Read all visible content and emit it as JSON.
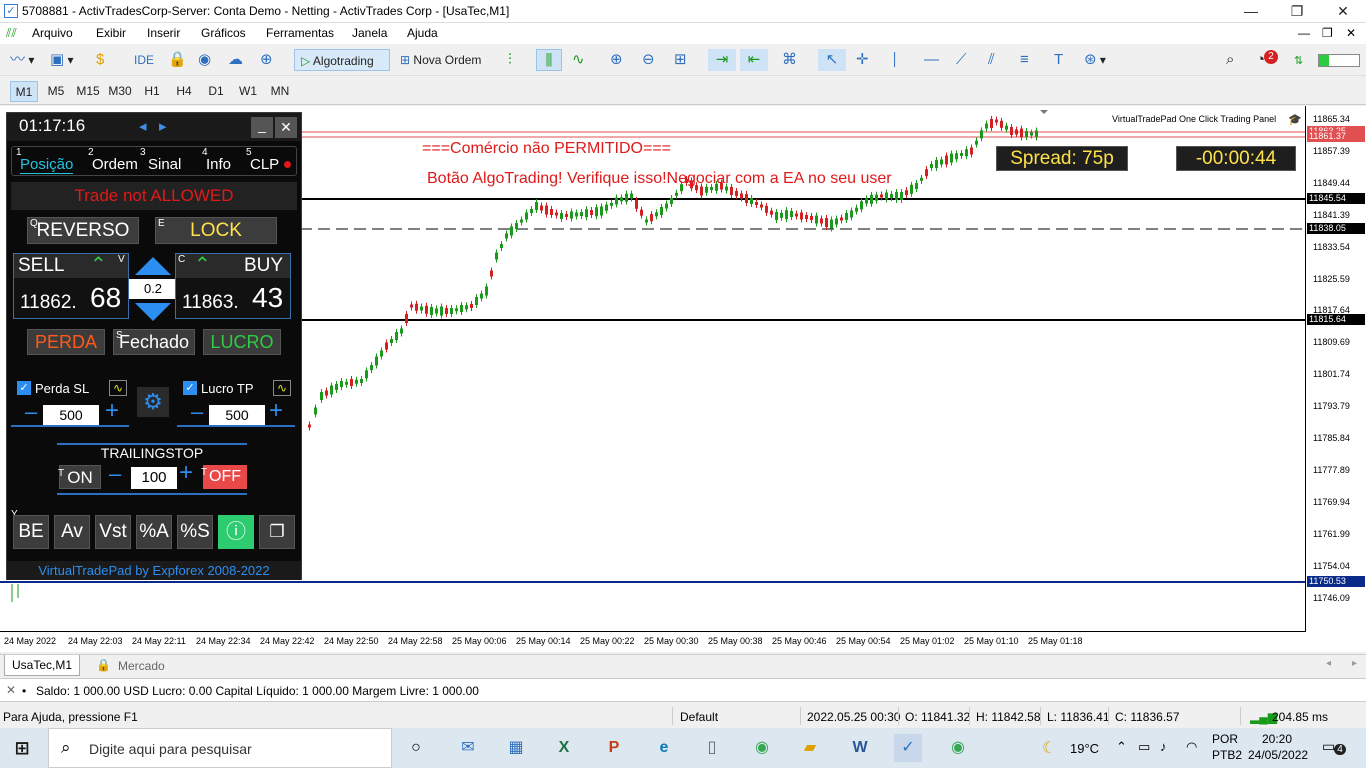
{
  "window": {
    "title": "5708881 - ActivTradesCorp-Server: Conta Demo - Netting - ActivTrades Corp - [UsaTec,M1]",
    "minimize": "—",
    "maximize": "❐",
    "close": "✕"
  },
  "menu": [
    "Arquivo",
    "Exibir",
    "Inserir",
    "Gráficos",
    "Ferramentas",
    "Janela",
    "Ajuda"
  ],
  "toolbar": {
    "ide": "IDE",
    "algotrading": "Algotrading",
    "nova_ordem": "Nova Ordem",
    "notif_count": "2"
  },
  "timeframes": [
    "M1",
    "M5",
    "M15",
    "M30",
    "H1",
    "H4",
    "D1",
    "W1",
    "MN"
  ],
  "active_timeframe": "M1",
  "chart": {
    "header_label": "VirtualTradePad One Click Trading Panel",
    "msg1": "===Comércio não PERMITIDO===",
    "msg2": "Botão AlgoTrading! Verifique isso!Negociar com a EA no seu user",
    "spread": "Spread: 75p",
    "timer": "-00:00:44",
    "price_labels": [
      "11865.34",
      "11857.39",
      "11849.44",
      "11841.39",
      "11833.54",
      "11825.59",
      "11817.64",
      "11809.69",
      "11801.74",
      "11793.79",
      "11785.84",
      "11777.89",
      "11769.94",
      "11761.99",
      "11754.04",
      "11746.09"
    ],
    "price_tags": [
      {
        "text": "11863.25",
        "color": "#e05050"
      },
      {
        "text": "11861.37",
        "color": "#e05050"
      },
      {
        "text": "11845.54",
        "color": "#000000"
      },
      {
        "text": "11838.05",
        "color": "#000000"
      },
      {
        "text": "11815.64",
        "color": "#000000"
      },
      {
        "text": "11750.53",
        "color": "#0a2a8a"
      }
    ],
    "time_labels": [
      "24 May 2022",
      "24 May 22:03",
      "24 May 22:11",
      "24 May 22:34",
      "24 May 22:42",
      "24 May 22:50",
      "24 May 22:58",
      "25 May 00:06",
      "25 May 00:14",
      "25 May 00:22",
      "25 May 00:30",
      "25 May 00:38",
      "25 May 00:46",
      "25 May 00:54",
      "25 May 01:02",
      "25 May 01:10",
      "25 May 01:18"
    ]
  },
  "panel": {
    "clock": "01:17:16",
    "nav_left": "◂",
    "nav_right": "▸",
    "min": "_",
    "close": "✕",
    "tabs": [
      {
        "num": "1",
        "label": "Posição"
      },
      {
        "num": "2",
        "label": "Ordem"
      },
      {
        "num": "3",
        "label": "Sinal"
      },
      {
        "num": "4",
        "label": "Info"
      },
      {
        "num": "5",
        "label": "CLP"
      }
    ],
    "trade_status": "Trade not ALLOWED",
    "reverso_key": "Q",
    "reverso": "REVERSO",
    "lock_key": "E",
    "lock": "LOCK",
    "sell_label": "SELL",
    "sell_key": "V",
    "sell_price_main": "11862.",
    "sell_price_big": "68",
    "buy_label": "BUY",
    "buy_key": "C",
    "buy_price_main": "11863.",
    "buy_price_big": "43",
    "lot": "0.2",
    "perda": "PERDA",
    "fechado_key": "S",
    "fechado": "Fechado",
    "lucro": "LUCRO",
    "sl_label": "Perda SL",
    "sl_value": "500",
    "tp_label": "Lucro TP",
    "tp_value": "500",
    "minus": "–",
    "plus": "+",
    "trailing_label": "TRAILINGSTOP",
    "ts_on_key": "T",
    "ts_on": "ON",
    "ts_value": "100",
    "ts_off_key": "T",
    "ts_off": "OFF",
    "bottom_key": "Y",
    "bottom_buttons": [
      "BE",
      "Av",
      "Vst",
      "%A",
      "%S"
    ],
    "footer": "VirtualTradePad by Expforex 2008-2022"
  },
  "tabs_bottom": [
    "UsaTec,M1",
    "Mercado"
  ],
  "account": "Saldo: 1 000.00 USD  Lucro: 0.00  Capital Líquido: 1 000.00  Margem Livre: 1 000.00",
  "status": {
    "help": "Para Ajuda, pressione F1",
    "profile": "Default",
    "datetime": "2022.05.25 00:30",
    "open": "O: 11841.32",
    "high": "H: 11842.58",
    "low": "L: 11836.41",
    "close": "C: 11836.57",
    "ping": "204.85 ms"
  },
  "taskbar": {
    "search": "Digite aqui para pesquisar",
    "weather": "19°C",
    "lang1": "POR",
    "lang2": "PTB2",
    "time": "20:20",
    "date": "24/05/2022",
    "notif": "4"
  },
  "colors": {
    "bull": "#1a9a1a",
    "bear": "#d42020",
    "accent": "#2f6fbf"
  }
}
